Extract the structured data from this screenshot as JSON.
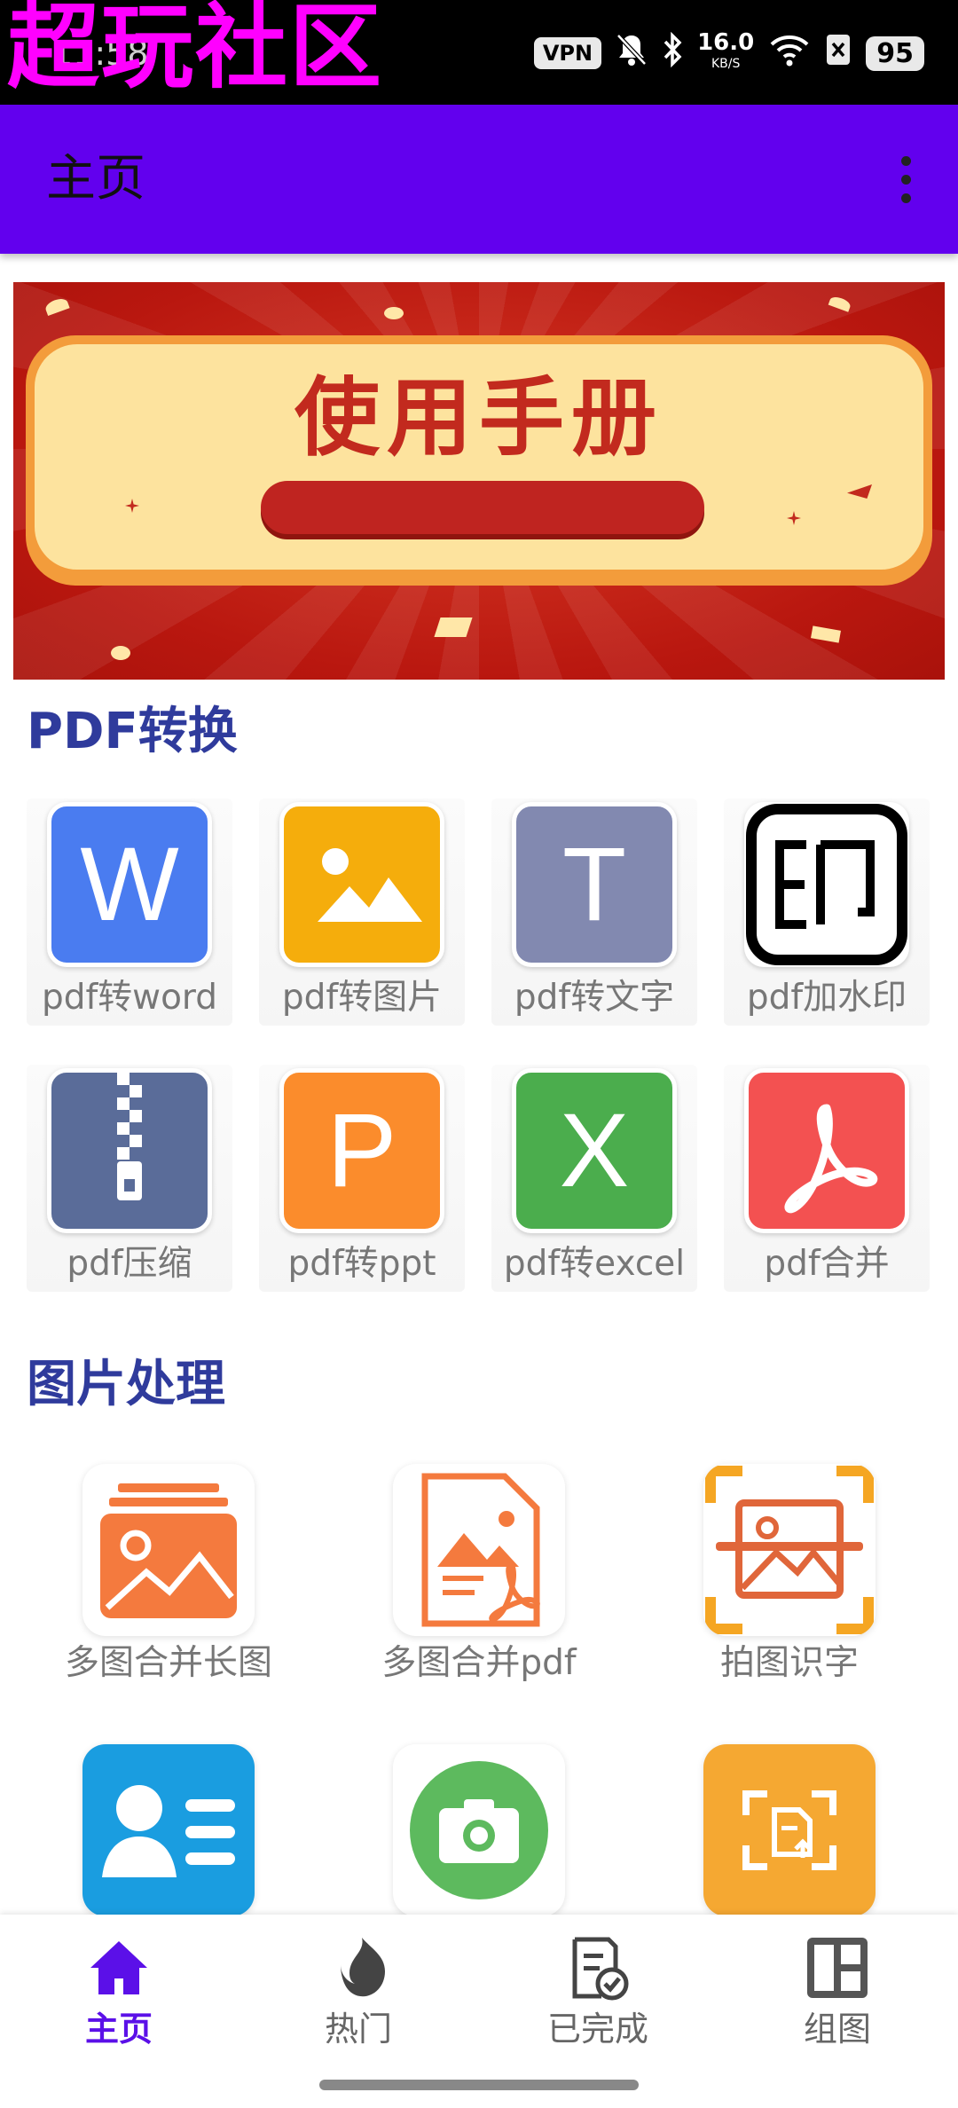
{
  "status_bar": {
    "watermark": "超玩社区",
    "time": "11:58",
    "vpn": "VPN",
    "net_speed": "16.0",
    "net_speed_unit": "KB/S",
    "battery": "95"
  },
  "app_bar": {
    "title": "主页",
    "overflow_icon": "more-vert-icon"
  },
  "banner": {
    "title": "使用手册",
    "colors": {
      "background": "#b9170f",
      "card": "#fde39e",
      "text": "#c22a1e"
    }
  },
  "pdf_section": {
    "title": "PDF转换",
    "items": [
      {
        "label": "pdf转word",
        "glyph": "W",
        "icon": "word-icon",
        "color": "#4a7cf0"
      },
      {
        "label": "pdf转图片",
        "glyph": "",
        "icon": "image-icon",
        "color": "#f5ad0c"
      },
      {
        "label": "pdf转文字",
        "glyph": "T",
        "icon": "text-icon",
        "color": "#8289b0"
      },
      {
        "label": "pdf加水印",
        "glyph": "",
        "icon": "watermark-icon",
        "color": "#ffffff"
      },
      {
        "label": "pdf压缩",
        "glyph": "",
        "icon": "zip-icon",
        "color": "#5a6c99"
      },
      {
        "label": "pdf转ppt",
        "glyph": "P",
        "icon": "ppt-icon",
        "color": "#fb8c2c"
      },
      {
        "label": "pdf转excel",
        "glyph": "X",
        "icon": "excel-icon",
        "color": "#4bad4d"
      },
      {
        "label": "pdf合并",
        "glyph": "",
        "icon": "acrobat-icon",
        "color": "#f35151"
      }
    ]
  },
  "image_section": {
    "title": "图片处理",
    "items": [
      {
        "label": "多图合并长图",
        "icon": "stacked-images-icon"
      },
      {
        "label": "多图合并pdf",
        "icon": "image-to-pdf-icon"
      },
      {
        "label": "拍图识字",
        "icon": "scan-image-icon"
      },
      {
        "label": "",
        "icon": "id-card-icon"
      },
      {
        "label": "",
        "icon": "camera-icon"
      },
      {
        "label": "",
        "icon": "document-scan-icon"
      }
    ]
  },
  "bottom_nav": {
    "items": [
      {
        "label": "主页",
        "icon": "home-icon",
        "active": true
      },
      {
        "label": "热门",
        "icon": "flame-icon",
        "active": false
      },
      {
        "label": "已完成",
        "icon": "checklist-icon",
        "active": false
      },
      {
        "label": "组图",
        "icon": "layout-icon",
        "active": false
      }
    ],
    "active_color": "#5b10e8"
  }
}
